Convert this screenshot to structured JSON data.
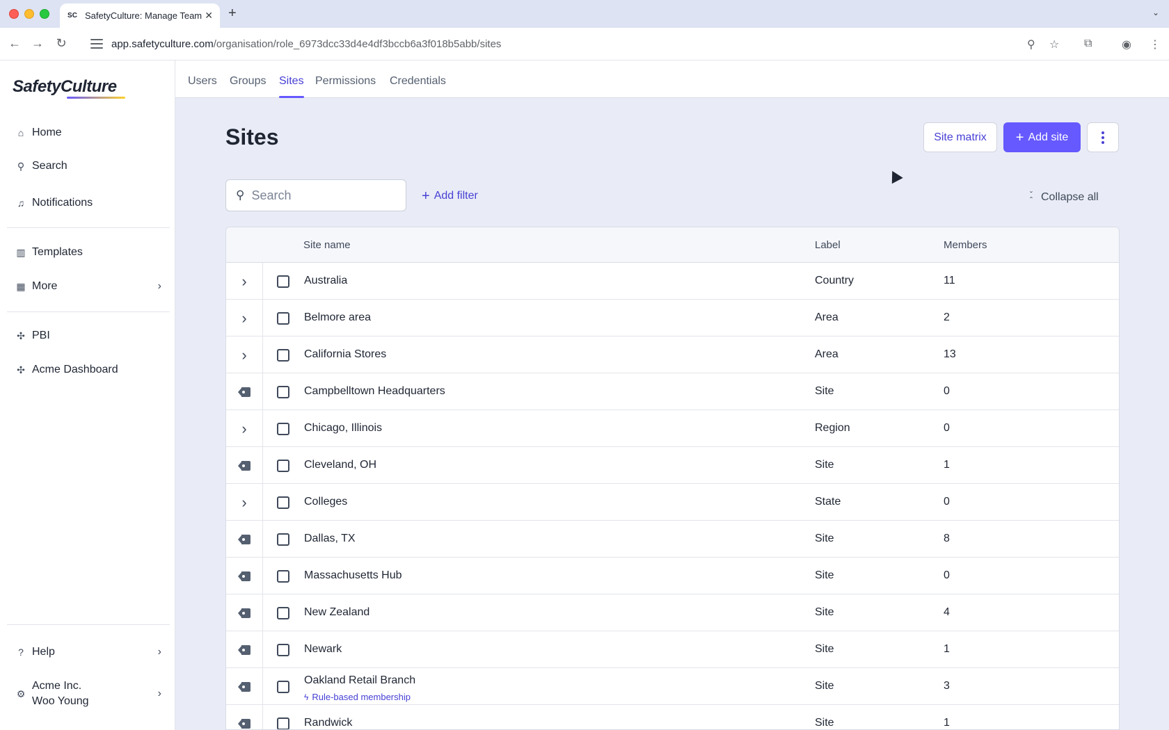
{
  "browser": {
    "tab_title": "SafetyCulture: Manage Teams",
    "favicon_text": "SC",
    "url_domain": "app.safetyculture.com",
    "url_path": "/organisation/role_6973dcc33d4e4df3bccb6a3f018b5abb/sites"
  },
  "sidebar": {
    "logo": "SafetyCulture",
    "items": [
      {
        "label": "Home",
        "icon": "home-icon"
      },
      {
        "label": "Search",
        "icon": "search-icon"
      },
      {
        "label": "Notifications",
        "icon": "bell-icon"
      },
      {
        "label": "Templates",
        "icon": "templates-icon"
      },
      {
        "label": "More",
        "icon": "grid-icon"
      },
      {
        "label": "PBI",
        "icon": "puzzle-icon"
      },
      {
        "label": "Acme Dashboard",
        "icon": "puzzle-icon"
      }
    ],
    "help_label": "Help",
    "account": {
      "org": "Acme Inc.",
      "user": "Woo Young"
    }
  },
  "topnav": {
    "tabs": [
      {
        "label": "Users",
        "active": false
      },
      {
        "label": "Groups",
        "active": false
      },
      {
        "label": "Sites",
        "active": true
      },
      {
        "label": "Permissions",
        "active": false
      },
      {
        "label": "Credentials",
        "active": false
      }
    ]
  },
  "page": {
    "title": "Sites",
    "site_matrix_label": "Site matrix",
    "add_site_label": "Add site",
    "search_placeholder": "Search",
    "add_filter_label": "Add filter",
    "collapse_all_label": "Collapse all"
  },
  "table": {
    "headers": {
      "name": "Site name",
      "label": "Label",
      "members": "Members"
    },
    "rows": [
      {
        "name": "Australia",
        "label": "Country",
        "members": "11",
        "kind": "expand"
      },
      {
        "name": "Belmore area",
        "label": "Area",
        "members": "2",
        "kind": "expand"
      },
      {
        "name": "California Stores",
        "label": "Area",
        "members": "13",
        "kind": "expand"
      },
      {
        "name": "Campbelltown Headquarters",
        "label": "Site",
        "members": "0",
        "kind": "tag"
      },
      {
        "name": "Chicago, Illinois",
        "label": "Region",
        "members": "0",
        "kind": "expand"
      },
      {
        "name": "Cleveland, OH",
        "label": "Site",
        "members": "1",
        "kind": "tag"
      },
      {
        "name": "Colleges",
        "label": "State",
        "members": "0",
        "kind": "expand"
      },
      {
        "name": "Dallas, TX",
        "label": "Site",
        "members": "8",
        "kind": "tag"
      },
      {
        "name": "Massachusetts Hub",
        "label": "Site",
        "members": "0",
        "kind": "tag"
      },
      {
        "name": "New Zealand",
        "label": "Site",
        "members": "4",
        "kind": "tag"
      },
      {
        "name": "Newark",
        "label": "Site",
        "members": "1",
        "kind": "tag"
      },
      {
        "name": "Oakland Retail Branch",
        "label": "Site",
        "members": "3",
        "kind": "tag",
        "badge": "Rule-based membership"
      },
      {
        "name": "Randwick",
        "label": "Site",
        "members": "1",
        "kind": "tag"
      }
    ]
  },
  "colors": {
    "accent": "#6559ff",
    "accent_text": "#4740d4",
    "background": "#e9ecf6"
  }
}
